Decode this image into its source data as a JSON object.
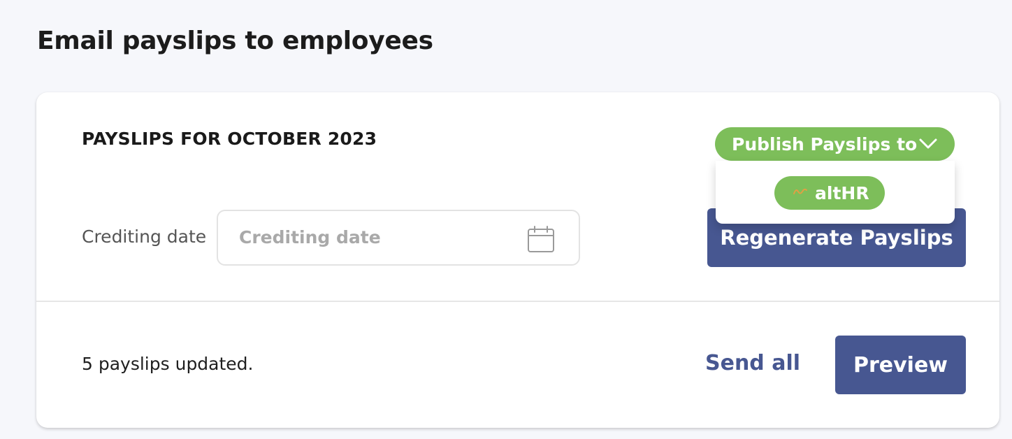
{
  "page": {
    "title": "Email payslips to employees"
  },
  "payslips": {
    "section_title": "PAYSLIPS FOR OCTOBER 2023",
    "crediting_date": {
      "label": "Crediting date",
      "placeholder": "Crediting date",
      "value": "",
      "icon": "calendar-icon"
    },
    "publish": {
      "label": "Publish Payslips to",
      "icon": "chevron-down-icon",
      "options": [
        {
          "label": "altHR",
          "icon": "althr-logo-icon"
        }
      ]
    },
    "regenerate_label": "Regenerate Payslips",
    "status_text": "5 payslips updated.",
    "send_all_label": "Send all",
    "preview_label": "Preview"
  },
  "colors": {
    "background": "#f6f7fb",
    "primary": "#475791",
    "success": "#7dbe5a",
    "althr_logo": "#e0a044"
  }
}
